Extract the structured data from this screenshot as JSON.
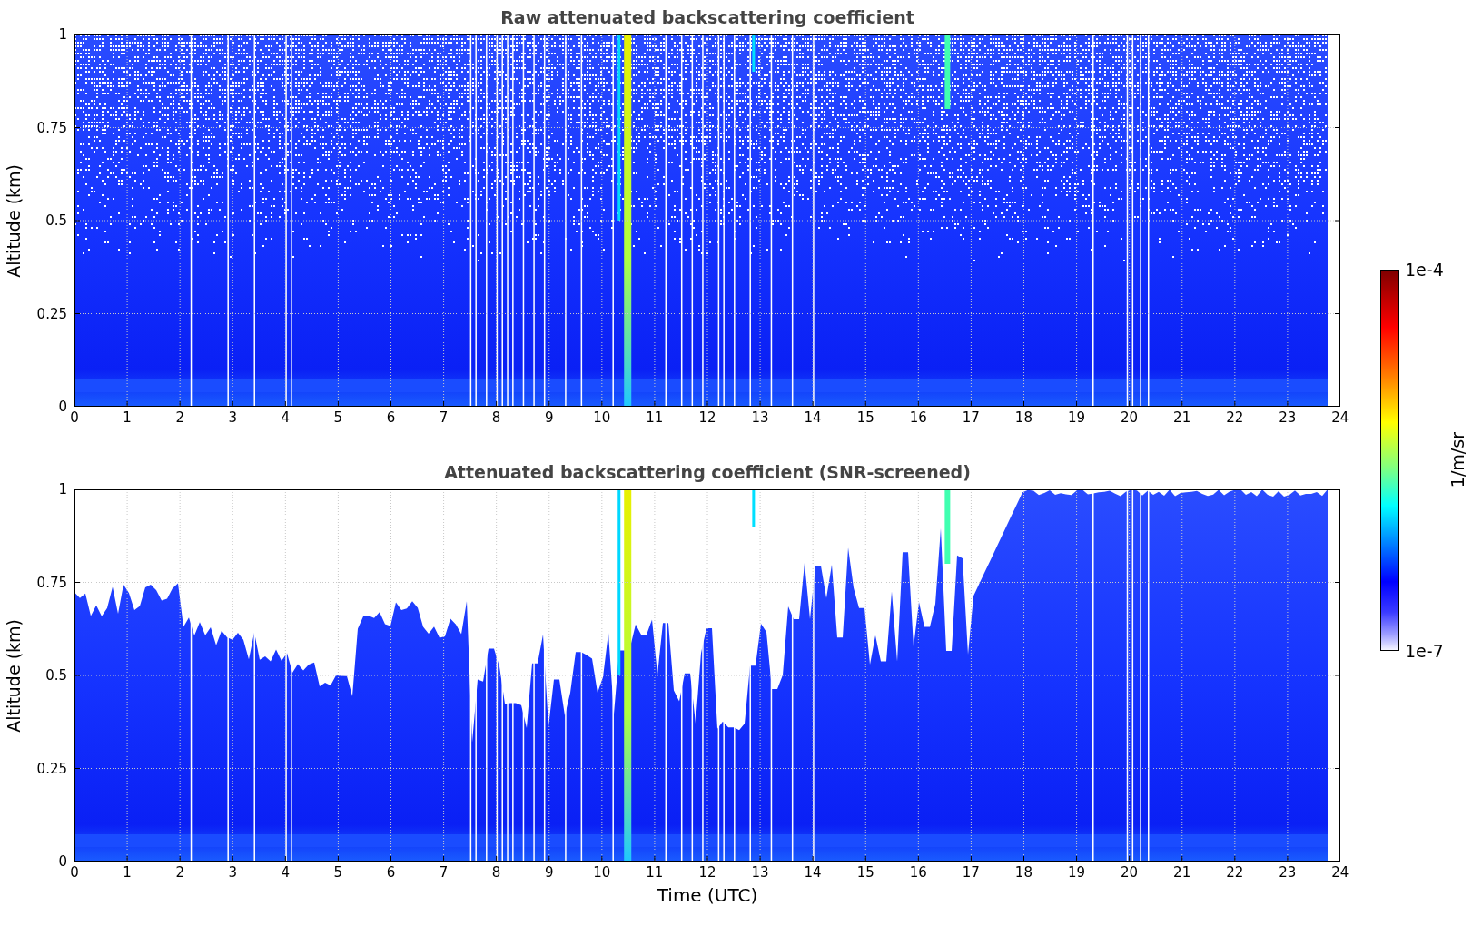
{
  "figure": {
    "panels": [
      {
        "kind": "raw",
        "title": "Raw attenuated backscattering coefficient",
        "ylabel": "Altitude (km)",
        "yticks": [
          "1",
          "0.75",
          "0.5",
          "0.25",
          "0"
        ],
        "xticks": [
          "0",
          "1",
          "2",
          "3",
          "4",
          "5",
          "6",
          "7",
          "8",
          "9",
          "10",
          "11",
          "12",
          "13",
          "14",
          "15",
          "16",
          "17",
          "18",
          "19",
          "20",
          "21",
          "22",
          "23",
          "24"
        ]
      },
      {
        "kind": "screened",
        "title": "Attenuated backscattering coefficient (SNR-screened)",
        "ylabel": "Altitude (km)",
        "yticks": [
          "1",
          "0.75",
          "0.5",
          "0.25",
          "0"
        ],
        "xticks": [
          "0",
          "1",
          "2",
          "3",
          "4",
          "5",
          "6",
          "7",
          "8",
          "9",
          "10",
          "11",
          "12",
          "13",
          "14",
          "15",
          "16",
          "17",
          "18",
          "19",
          "20",
          "21",
          "22",
          "23",
          "24"
        ]
      }
    ],
    "xlabel": "Time (UTC)",
    "colorbar": {
      "max_label": "1e-4",
      "min_label": "1e-7",
      "label": "1/m/sr"
    }
  }
}
